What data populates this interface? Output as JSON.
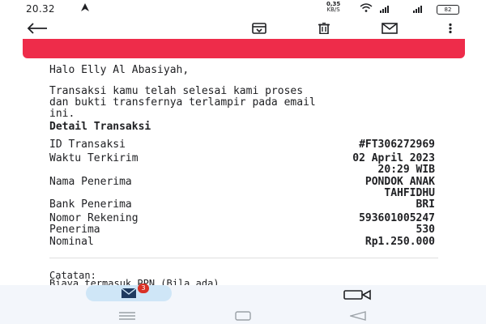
{
  "status_bar": {
    "time": "20.32",
    "speed_value": "0,35",
    "speed_unit": "KB/S",
    "battery": "82"
  },
  "toolbar": {
    "back_icon": "arrow-left-icon",
    "archive_icon": "archive-icon",
    "delete_icon": "trash-icon",
    "mark_unread_icon": "mail-icon",
    "more_icon": "more-vert-icon"
  },
  "email": {
    "greeting": "Halo Elly Al Abasiyah,",
    "message_line1": "Transaksi kamu telah selesai kami proses",
    "message_line2": "dan bukti transfernya terlampir pada email",
    "message_line3": "ini.",
    "section_title": "Detail Transaksi",
    "rows": [
      {
        "label": "ID Transaksi",
        "value": "#FT306272969"
      },
      {
        "label": "Waktu Terkirim",
        "value_line1": "02 April 2023",
        "value_line2": "20:29 WIB"
      },
      {
        "label": "Nama Penerima",
        "value_line1": "PONDOK ANAK",
        "value_line2": "TAHFIDHU"
      },
      {
        "label": "Bank Penerima",
        "value": "BRI"
      },
      {
        "label_line1": "Nomor Rekening",
        "label_line2": "Penerima",
        "value_line1": "593601005247",
        "value_line2": "530"
      },
      {
        "label": "Nominal",
        "value": "Rp1.250.000"
      }
    ],
    "notes_label": "Catatan:",
    "notes_text": "Biaya termasuk PPN (Bila ada)"
  },
  "bottom_bar": {
    "mail_badge": "3",
    "mail_icon": "mail-icon",
    "meet_icon": "video-camera-icon"
  },
  "colors": {
    "banner": "#ee2c4a",
    "pill": "#cfe6f7",
    "badge": "#d93025"
  }
}
